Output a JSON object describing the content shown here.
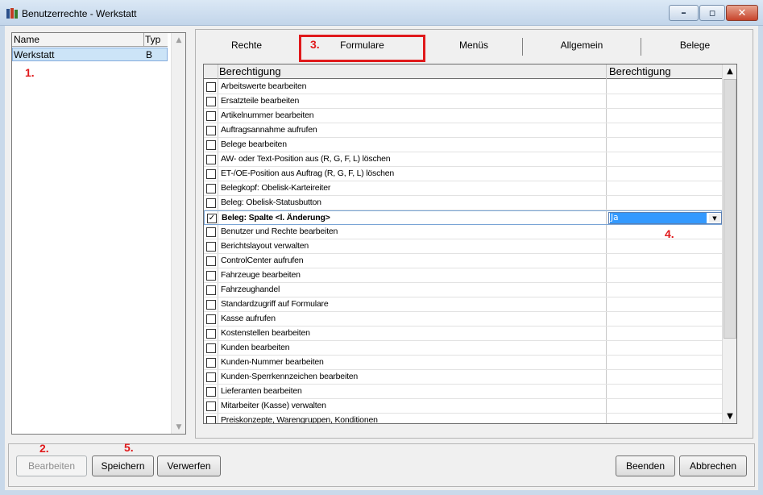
{
  "window": {
    "title": "Benutzerrechte - Werkstatt",
    "min_glyph": "–",
    "max_glyph": "▫",
    "close_glyph": "✕"
  },
  "left_list": {
    "columns": [
      "Name",
      "Typ"
    ],
    "rows": [
      {
        "name": "Werkstatt",
        "typ": "B"
      }
    ]
  },
  "tabs": [
    "Rechte",
    "Formulare",
    "Menüs",
    "Allgemein",
    "Belege"
  ],
  "active_tab": "Formulare",
  "grid": {
    "columns": [
      "Berechtigung",
      "Berechtigung"
    ],
    "rows": [
      {
        "label": "Arbeitswerte bearbeiten",
        "checked": false
      },
      {
        "label": "Ersatzteile bearbeiten",
        "checked": false
      },
      {
        "label": "Artikelnummer bearbeiten",
        "checked": false
      },
      {
        "label": "Auftragsannahme aufrufen",
        "checked": false
      },
      {
        "label": "Belege bearbeiten",
        "checked": false
      },
      {
        "label": "AW- oder Text-Position aus (R, G, F, L) löschen",
        "checked": false
      },
      {
        "label": "ET-/OE-Position aus Auftrag (R, G, F, L) löschen",
        "checked": false
      },
      {
        "label": "Belegkopf: Obelisk-Karteireiter",
        "checked": false
      },
      {
        "label": "Beleg: Obelisk-Statusbutton",
        "checked": false
      },
      {
        "label": "Beleg: Spalte <l. Änderung>",
        "checked": true,
        "value": "Ja",
        "selected": true
      },
      {
        "label": "Benutzer und Rechte bearbeiten",
        "checked": false
      },
      {
        "label": "Berichtslayout verwalten",
        "checked": false
      },
      {
        "label": "ControlCenter aufrufen",
        "checked": false
      },
      {
        "label": "Fahrzeuge bearbeiten",
        "checked": false
      },
      {
        "label": "Fahrzeughandel",
        "checked": false
      },
      {
        "label": "Standardzugriff auf Formulare",
        "checked": false
      },
      {
        "label": "Kasse aufrufen",
        "checked": false
      },
      {
        "label": "Kostenstellen bearbeiten",
        "checked": false
      },
      {
        "label": "Kunden bearbeiten",
        "checked": false
      },
      {
        "label": "Kunden-Nummer bearbeiten",
        "checked": false
      },
      {
        "label": "Kunden-Sperrkennzeichen bearbeiten",
        "checked": false
      },
      {
        "label": "Lieferanten bearbeiten",
        "checked": false
      },
      {
        "label": "Mitarbeiter (Kasse) verwalten",
        "checked": false
      },
      {
        "label": "Preiskonzepte, Warengruppen, Konditionen",
        "checked": false
      }
    ]
  },
  "buttons": {
    "bearbeiten": "Bearbeiten",
    "speichern": "Speichern",
    "verwerfen": "Verwerfen",
    "beenden": "Beenden",
    "abbrechen": "Abbrechen"
  },
  "annotations": [
    "1.",
    "2.",
    "3.",
    "4.",
    "5."
  ],
  "colors": {
    "annotation": "#e0191b",
    "selection": "#3399ff"
  }
}
